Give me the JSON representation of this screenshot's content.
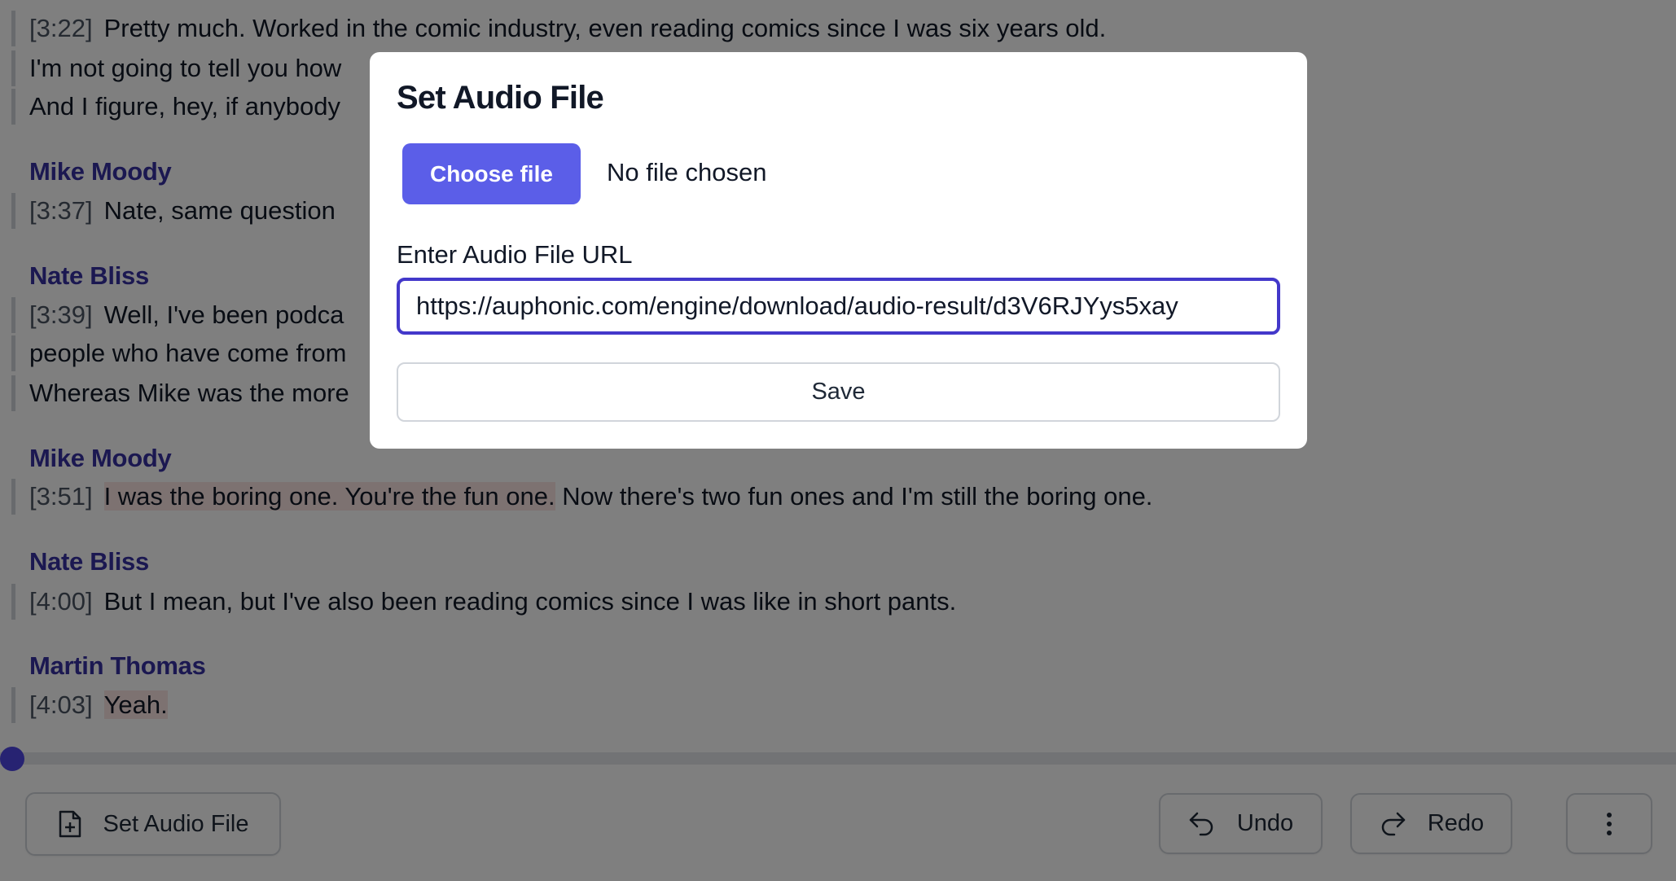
{
  "transcript": {
    "blocks": [
      {
        "lines": [
          {
            "timestamp": "[3:22]",
            "text": "Pretty much. Worked in the comic industry, even reading comics since I was six years old."
          },
          {
            "timestamp": "",
            "text": "I'm not going to tell you how"
          },
          {
            "timestamp": "",
            "text": "And I figure, hey, if anybody"
          }
        ]
      },
      {
        "speaker": "Mike Moody",
        "lines": [
          {
            "timestamp": "[3:37]",
            "text": "Nate, same question"
          }
        ]
      },
      {
        "speaker": "Nate Bliss",
        "lines": [
          {
            "timestamp": "[3:39]",
            "text": "Well, I've been podca"
          },
          {
            "timestamp": "",
            "text": "people who have come from"
          },
          {
            "timestamp": "",
            "text": "Whereas Mike was the more"
          }
        ]
      },
      {
        "speaker": "Mike Moody",
        "lines": [
          {
            "timestamp": "[3:51]",
            "highlight": "I was the boring one. You're the fun one.",
            "text": " Now there's two fun ones and I'm still the boring one."
          }
        ]
      },
      {
        "speaker": "Nate Bliss",
        "lines": [
          {
            "timestamp": "[4:00]",
            "text": "But I mean, but I've also been reading comics since I was like in short pants."
          }
        ]
      },
      {
        "speaker": "Martin Thomas",
        "lines": [
          {
            "timestamp": "[4:03]",
            "highlight": "Yeah.",
            "text": ""
          }
        ]
      }
    ]
  },
  "player": {
    "progress_percent": 0
  },
  "toolbar": {
    "set_audio_label": "Set Audio File",
    "set_audio_icon": "file-plus-icon",
    "undo_label": "Undo",
    "undo_icon": "undo-icon",
    "redo_label": "Redo",
    "redo_icon": "redo-icon",
    "more_icon": "more-vertical-icon"
  },
  "modal": {
    "title": "Set Audio File",
    "choose_file_label": "Choose file",
    "no_file_text": "No file chosen",
    "url_label": "Enter Audio File URL",
    "url_value": "https://auphonic.com/engine/download/audio-result/d3V6RJYys5xay",
    "save_label": "Save"
  },
  "colors": {
    "accent": "#4f46e5",
    "speaker": "#3730a3",
    "highlight": "#fbe4e2"
  }
}
